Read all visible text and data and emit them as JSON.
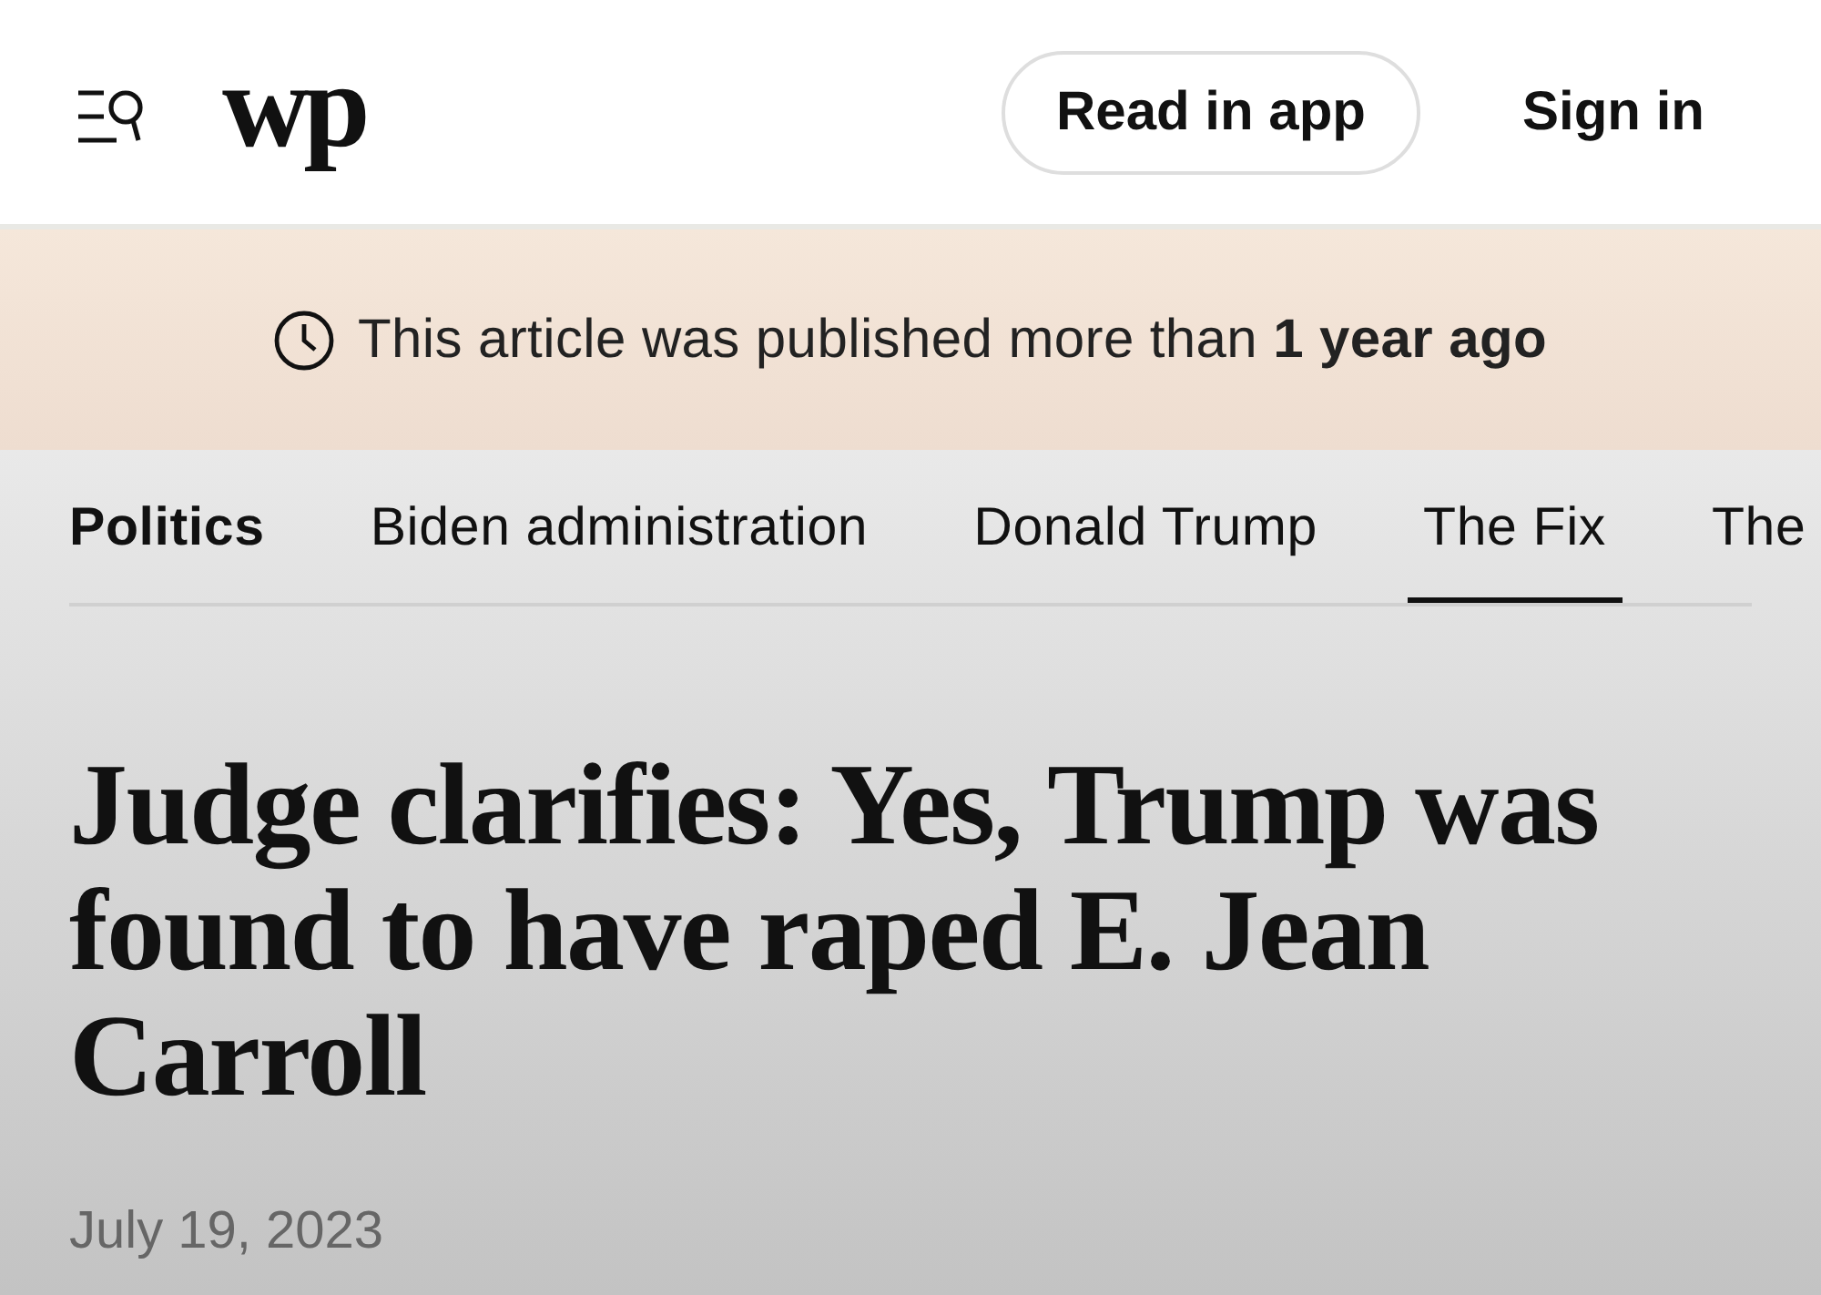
{
  "header": {
    "logo": "wp",
    "buttons": [
      {
        "label": "Read in app",
        "kind": "outlined"
      },
      {
        "label": "Sign in",
        "kind": "plain"
      }
    ]
  },
  "banner": {
    "text": "This article was published more than **1 year ago**"
  },
  "nav": {
    "section": "Politics",
    "items": [
      {
        "label": "Biden administration",
        "selected": false
      },
      {
        "label": "Donald Trump",
        "selected": false
      },
      {
        "label": "The Fix",
        "selected": true
      },
      {
        "label": "The",
        "selected": false
      }
    ]
  },
  "article": {
    "headline": "Judge clarifies: Yes, Trump was found to have raped E. Jean Carroll",
    "date": "July 19, 2023"
  }
}
